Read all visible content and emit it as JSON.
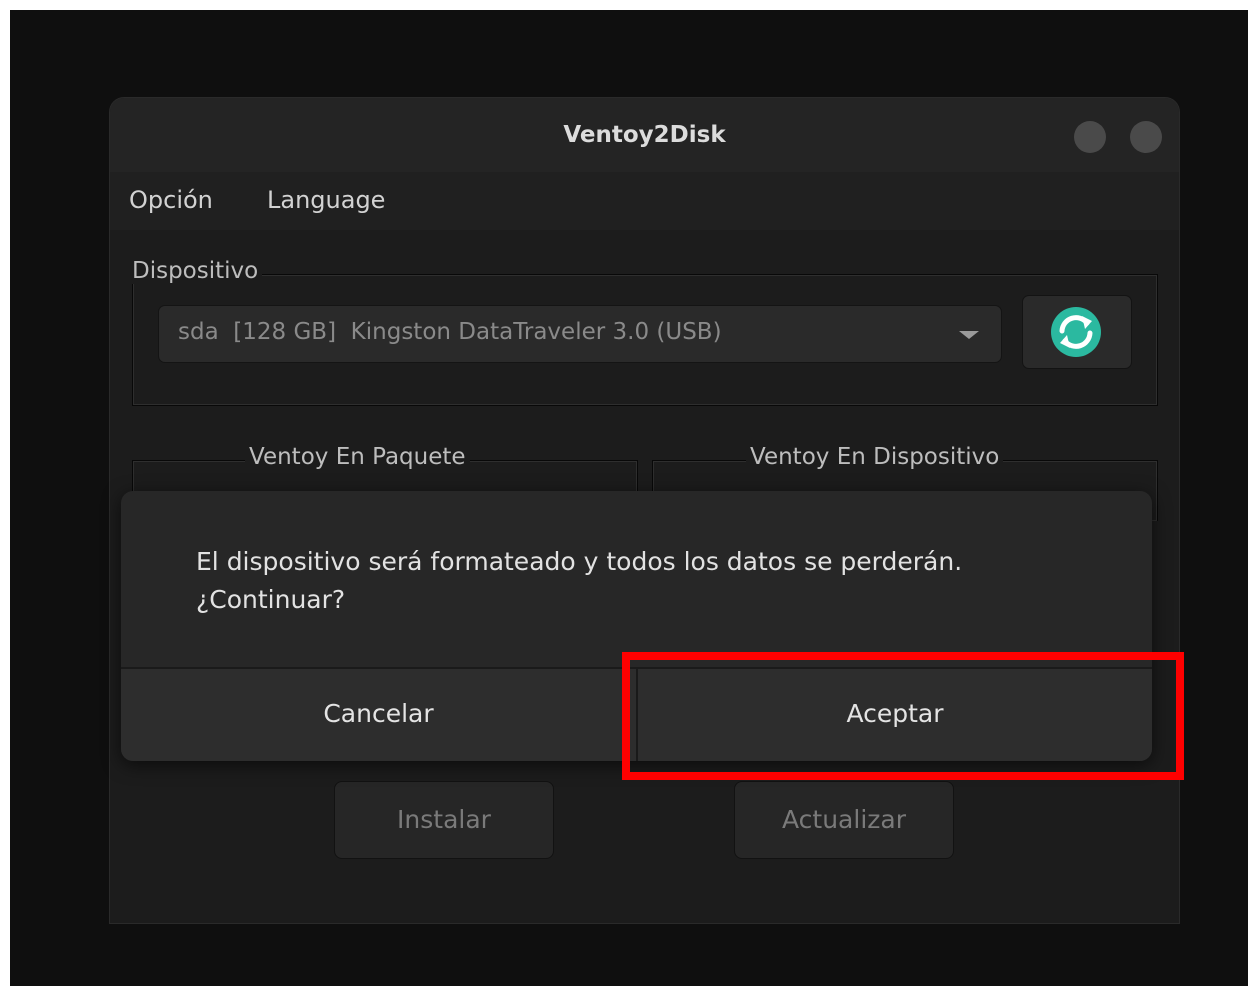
{
  "window": {
    "title": "Ventoy2Disk"
  },
  "menu": {
    "option": "Opción",
    "language": "Language"
  },
  "device_group": {
    "label": "Dispositivo",
    "selected_device": "sda  [128 GB]  Kingston DataTraveler 3.0 (USB)"
  },
  "version_groups": {
    "package_label": "Ventoy En Paquete",
    "device_label": "Ventoy En Dispositivo"
  },
  "actions": {
    "install": "Instalar",
    "update": "Actualizar"
  },
  "dialog": {
    "message_line1": "El dispositivo será formateado y todos los datos se perderán.",
    "message_line2": "¿Continuar?",
    "cancel": "Cancelar",
    "accept": "Aceptar"
  },
  "colors": {
    "refresh_icon": "#2bb9a0",
    "highlight": "#ff0000"
  },
  "icons": {
    "refresh": "refresh-icon",
    "dropdown": "chevron-down-icon"
  }
}
